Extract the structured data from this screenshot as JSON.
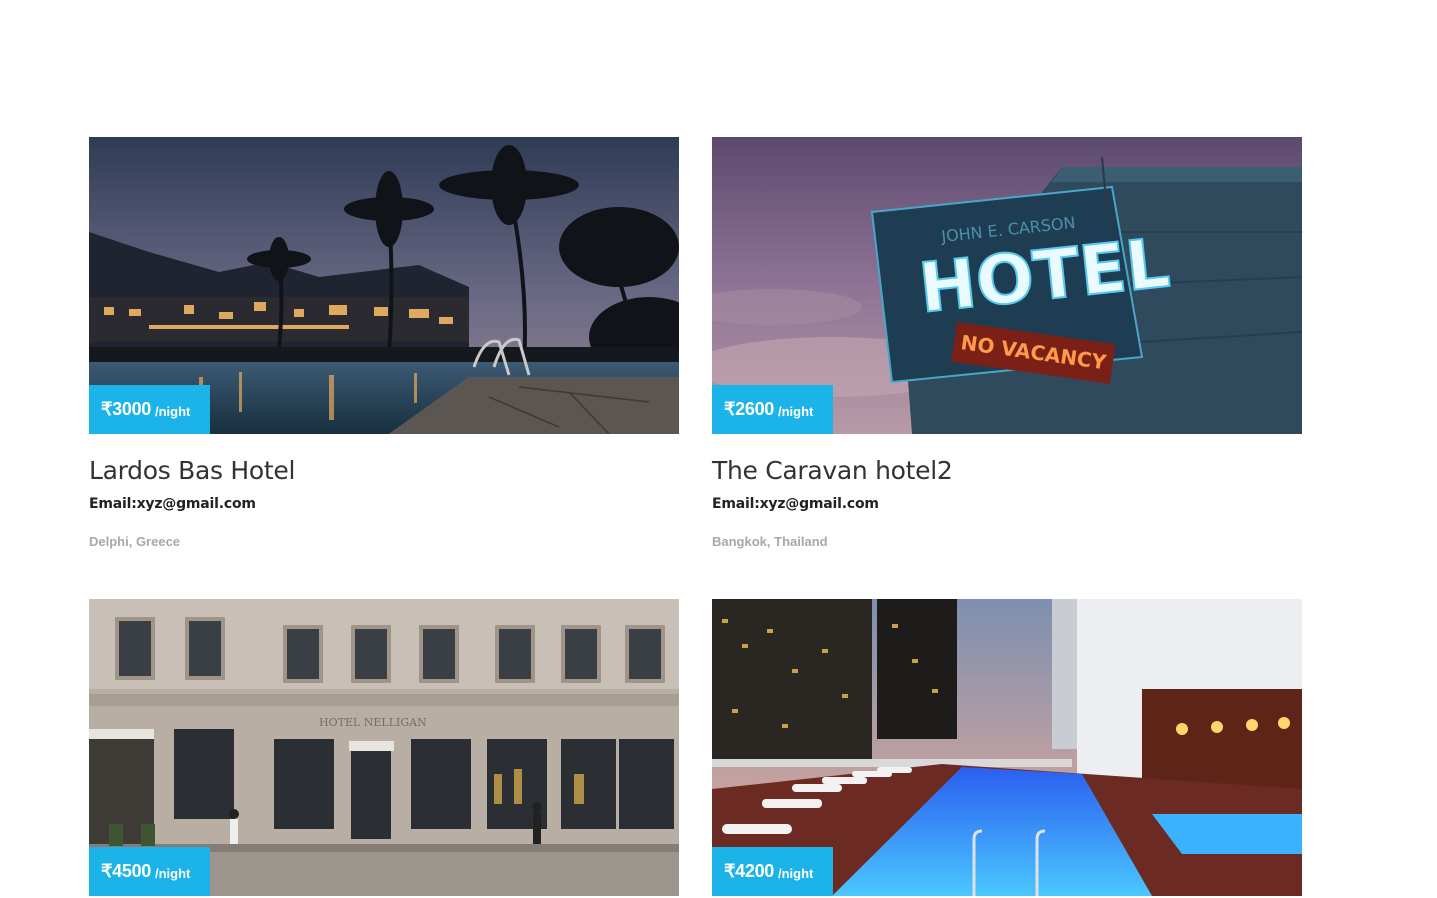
{
  "listings": [
    {
      "price": "₹3000",
      "per": "/night",
      "name": "Lardos Bas Hotel",
      "email": "Email:xyz@gmail.com",
      "location": "Delphi, Greece",
      "photo": "tropical-resort-pool-dusk"
    },
    {
      "price": "₹2600",
      "per": "/night",
      "name": "The Caravan hotel2",
      "email": "Email:xyz@gmail.com",
      "location": "Bangkok, Thailand",
      "photo": "neon-hotel-sign",
      "sign_text": "HOTEL",
      "sign_subtext": "NO VACANCY",
      "sign_top": "JOHN E. CARSON"
    },
    {
      "price": "₹4500",
      "per": "/night",
      "photo": "stone-hotel-facade",
      "facade_text": "HOTEL NELLIGAN"
    },
    {
      "price": "₹4200",
      "per": "/night",
      "photo": "rooftop-pool-city"
    }
  ],
  "colors": {
    "price_badge": "#1cb4e8",
    "title": "#333333",
    "location": "#a8a8a8"
  }
}
